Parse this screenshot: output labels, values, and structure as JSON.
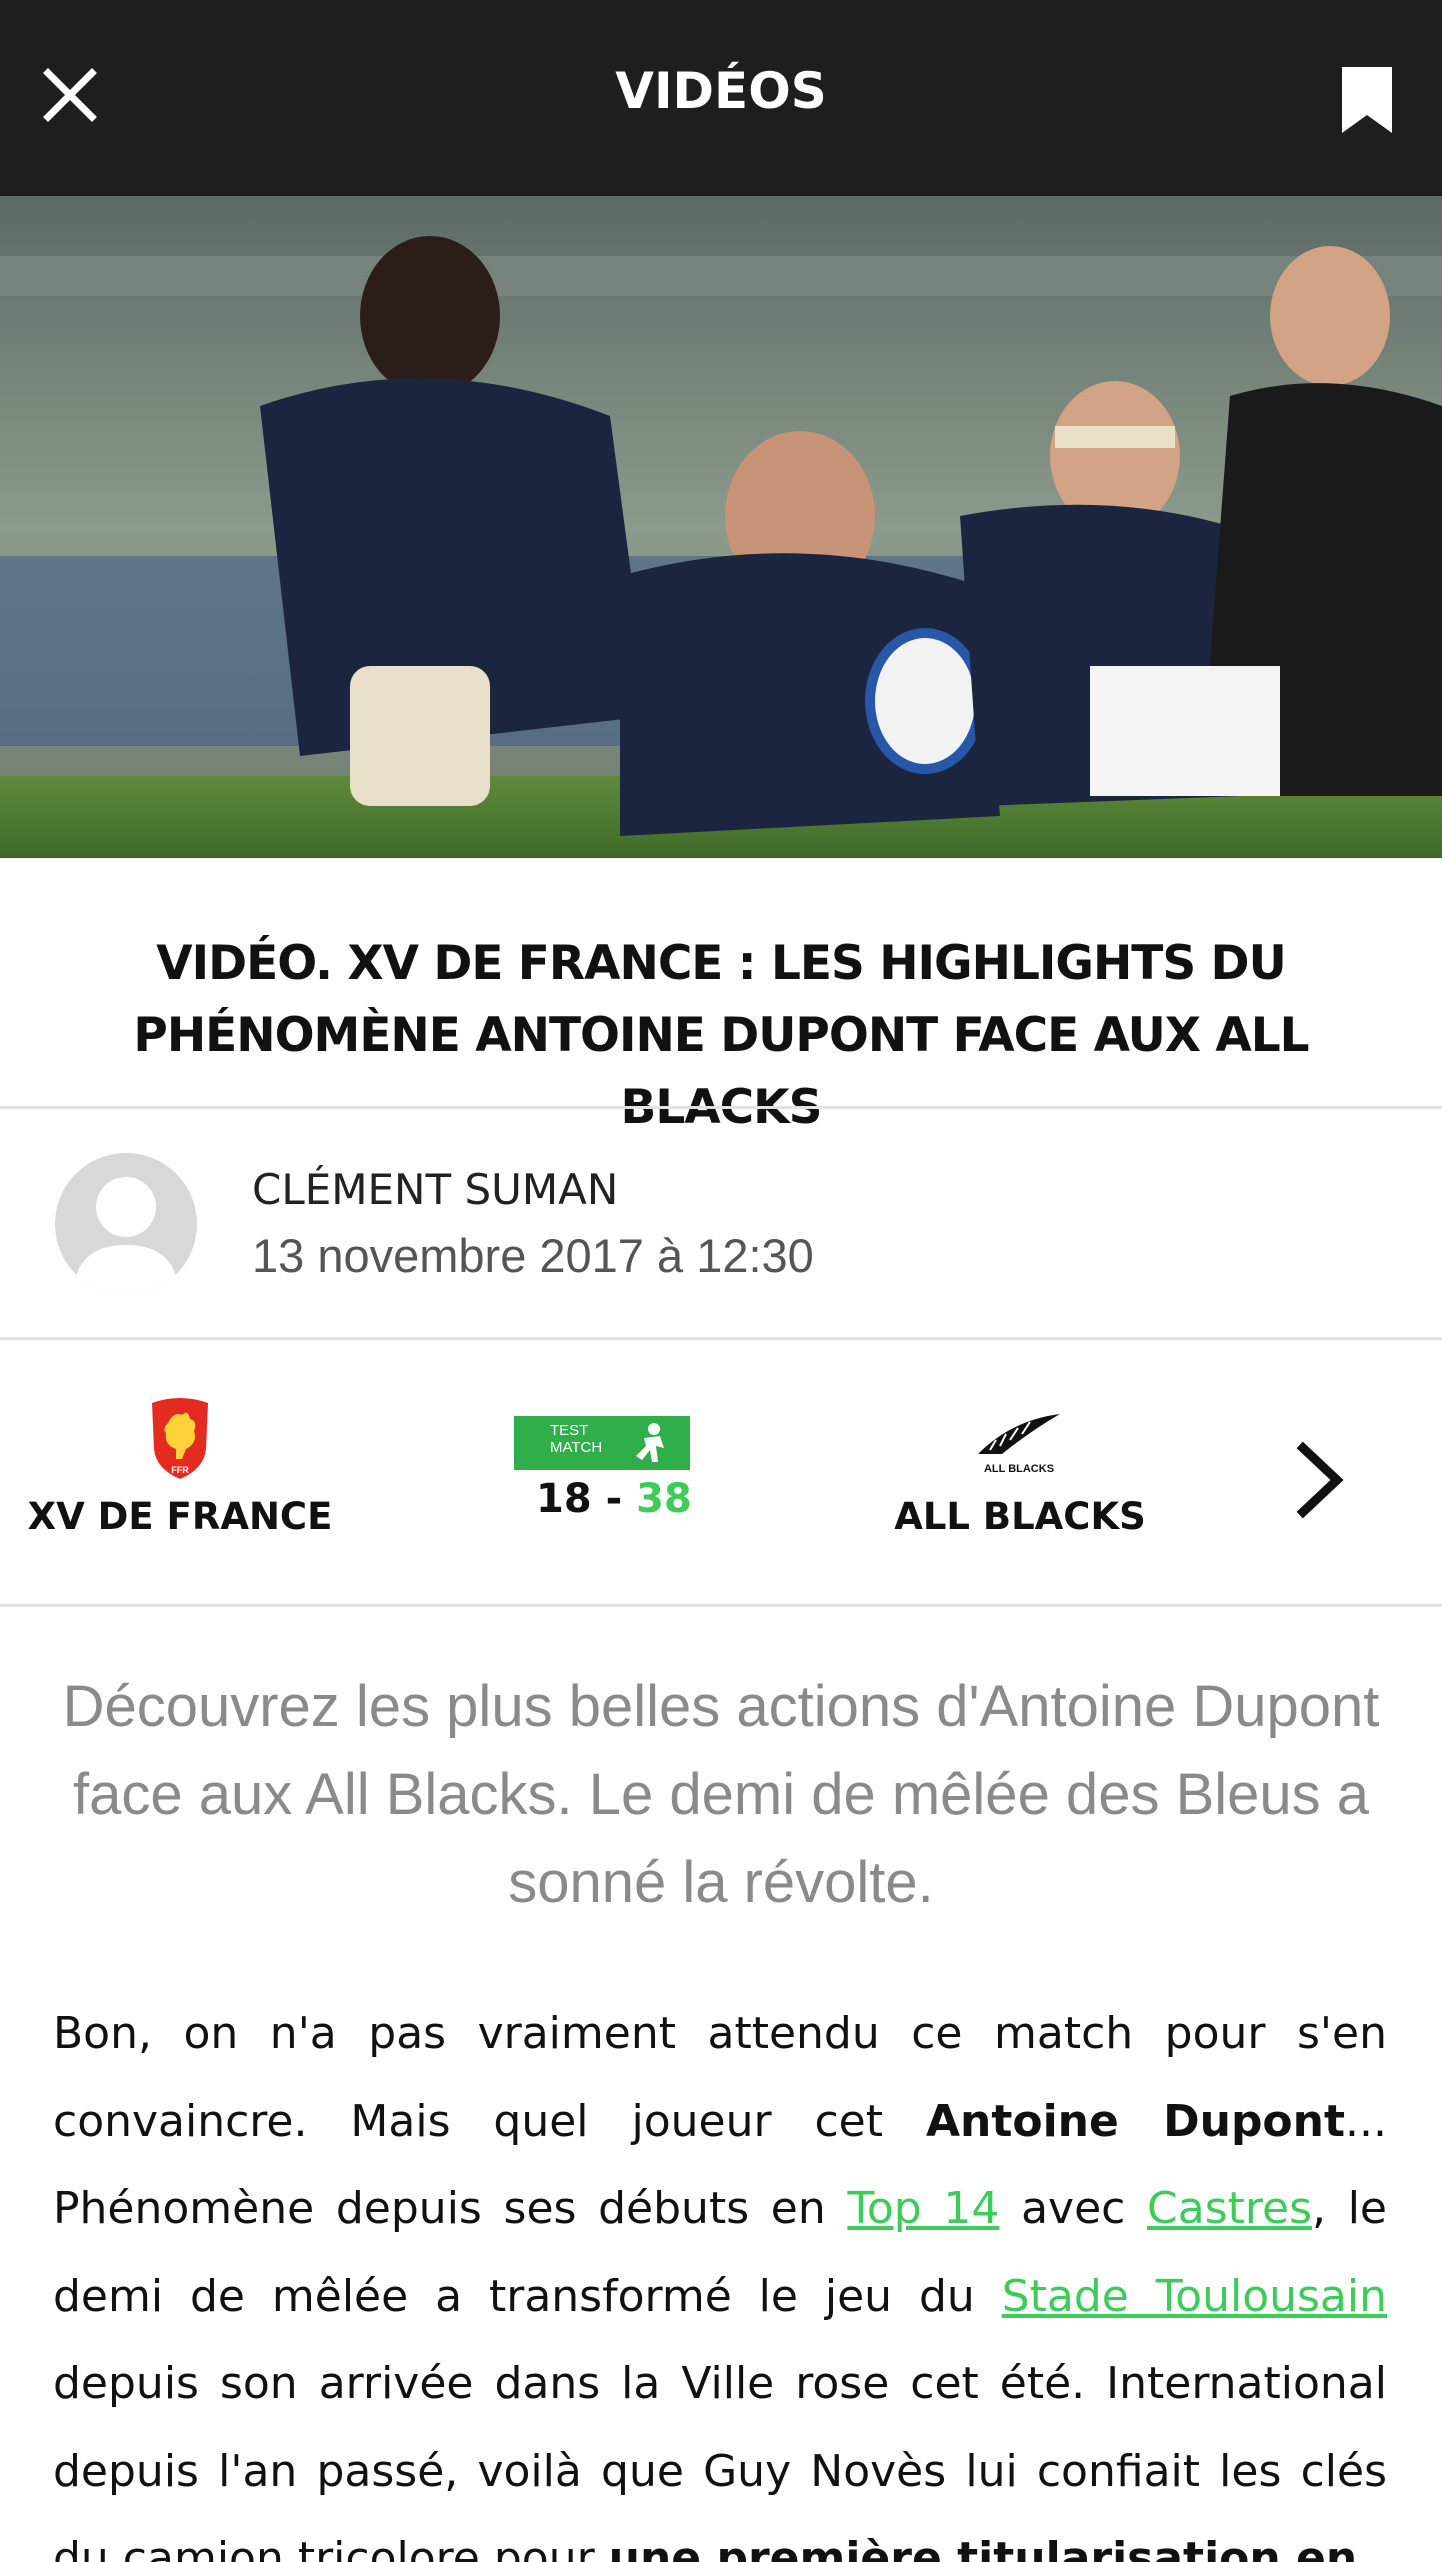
{
  "header": {
    "title": "VIDÉOS",
    "close_icon": "close-icon",
    "bookmark_icon": "bookmark-icon"
  },
  "hero": {
    "image": "rugby-players-running-photo"
  },
  "article": {
    "title_line1": "VIDÉO. XV DE FRANCE : LES HIGHLIGHTS DU",
    "title_line2": "PHÉNOMÈNE ANTOINE DUPONT FACE AUX ALL BLACKS",
    "author": "CLÉMENT SUMAN",
    "date": "13 novembre 2017 à 12:30",
    "lead": "Découvrez les plus belles actions d'Antoine Dupont face aux All Blacks. Le demi de mêlée des Bleus a sonné la révolte.",
    "body": {
      "p1": "Bon, on n'a pas vraiment attendu ce match pour s'en convaincre. Mais quel joueur cet ",
      "bold1": "Antoine Dupont",
      "p2": "... Phénomène depuis ses débuts en ",
      "link1": "Top 14",
      "p3": " avec ",
      "link2": "Castres",
      "p4": ", le demi de mêlée a transformé le jeu du ",
      "link3": "Stade Toulousain",
      "p5": " depuis son arrivée dans la Ville rose cet été. International depuis l'an passé, voilà que Guy Novès lui confiait les clés du camion tricolore pour ",
      "bold2": "une première titularisation en"
    }
  },
  "match": {
    "home_team": "XV DE FRANCE",
    "away_team": "ALL BLACKS",
    "competition_line1": "TEST",
    "competition_line2": "MATCH",
    "home_score": "18",
    "separator": " - ",
    "away_score": "38",
    "home_logo_text": "FFR",
    "away_logo_text": "ALL BLACKS",
    "colors": {
      "competition_badge": "#2fae49",
      "away_score": "#3dcc5a",
      "home_logo": "#e32b20"
    }
  },
  "colors": {
    "topbar": "#1e1e1e",
    "link": "#3dcc5a",
    "lead_text": "#8a8a8a"
  }
}
